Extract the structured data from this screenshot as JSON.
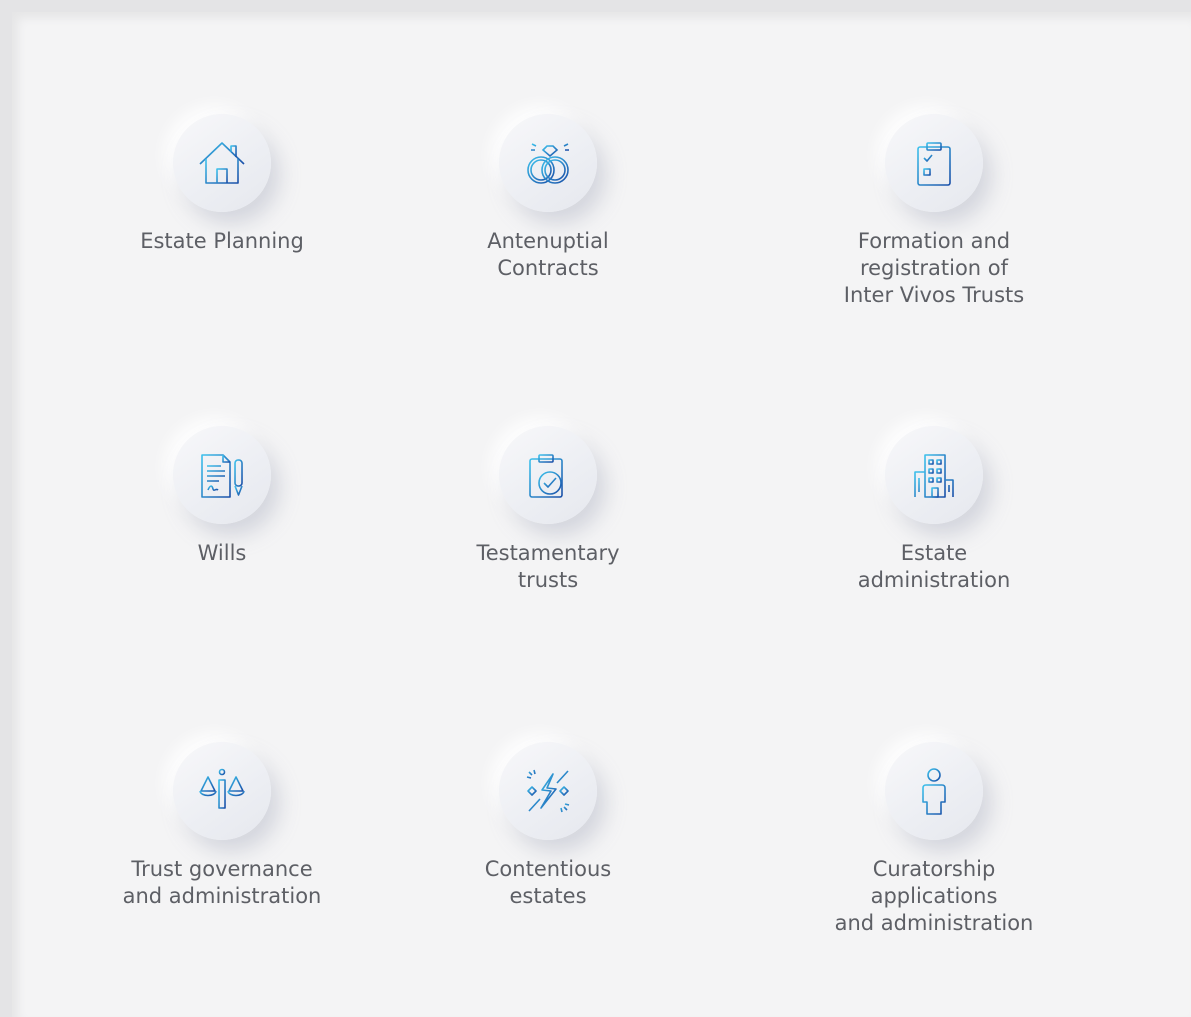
{
  "services": [
    {
      "label": "Estate Planning",
      "icon": "house-icon"
    },
    {
      "label": "Antenuptial\nContracts",
      "icon": "wedding-rings-icon"
    },
    {
      "label": "Formation and\nregistration of\nInter Vivos Trusts",
      "icon": "clipboard-checklist-icon"
    },
    {
      "label": "Wills",
      "icon": "document-pen-icon"
    },
    {
      "label": "Testamentary\ntrusts",
      "icon": "clipboard-check-icon"
    },
    {
      "label": "Estate\nadministration",
      "icon": "buildings-icon"
    },
    {
      "label": "Trust governance\nand administration",
      "icon": "scales-icon"
    },
    {
      "label": "Contentious\nestates",
      "icon": "disconnect-lightning-icon"
    },
    {
      "label": "Curatorship\napplications\nand administration",
      "icon": "person-icon"
    }
  ],
  "colors": {
    "icon_start": "#3dc1ec",
    "icon_end": "#1a4fa8",
    "label": "#5d5f65"
  }
}
